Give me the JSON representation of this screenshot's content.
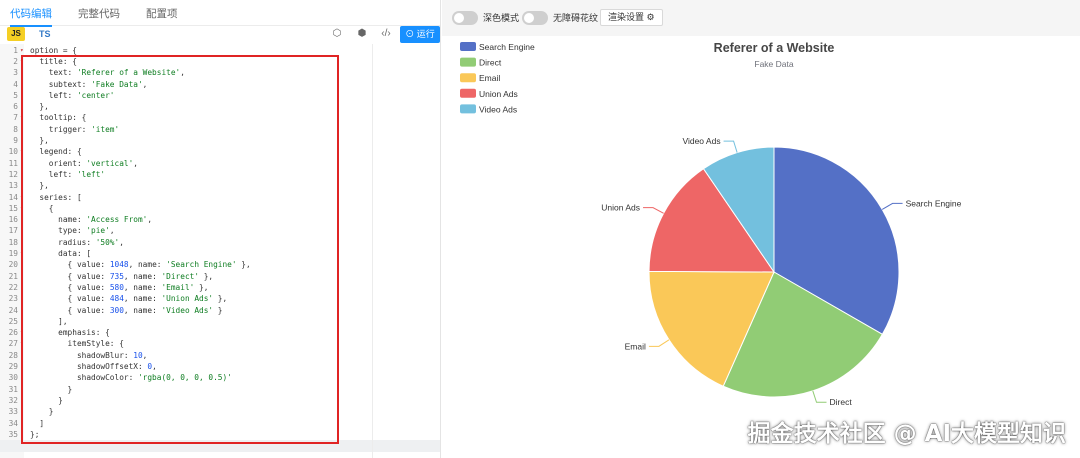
{
  "tabs": [
    {
      "label": "代码编辑",
      "active": true
    },
    {
      "label": "完整代码",
      "active": false
    },
    {
      "label": "配置项",
      "active": false
    }
  ],
  "lang": {
    "js": "JS",
    "ts": "TS"
  },
  "toolbar": {
    "run_label": "⊙ 运行",
    "icons": [
      "cube-outline-icon",
      "cube-solid-icon",
      "code-icon"
    ]
  },
  "editor": {
    "lines": [
      [
        [
          "",
          "option = {"
        ]
      ],
      [
        [
          "",
          "  title: {"
        ]
      ],
      [
        [
          "",
          "    text: "
        ],
        [
          "s",
          "'Referer of a Website'"
        ],
        [
          "",
          ","
        ]
      ],
      [
        [
          "",
          "    subtext: "
        ],
        [
          "s",
          "'Fake Data'"
        ],
        [
          "",
          ","
        ]
      ],
      [
        [
          "",
          "    left: "
        ],
        [
          "s",
          "'center'"
        ]
      ],
      [
        [
          "",
          "  },"
        ]
      ],
      [
        [
          "",
          "  tooltip: {"
        ]
      ],
      [
        [
          "",
          "    trigger: "
        ],
        [
          "s",
          "'item'"
        ]
      ],
      [
        [
          "",
          "  },"
        ]
      ],
      [
        [
          "",
          "  legend: {"
        ]
      ],
      [
        [
          "",
          "    orient: "
        ],
        [
          "s",
          "'vertical'"
        ],
        [
          "",
          ","
        ]
      ],
      [
        [
          "",
          "    left: "
        ],
        [
          "s",
          "'left'"
        ]
      ],
      [
        [
          "",
          "  },"
        ]
      ],
      [
        [
          "",
          "  series: ["
        ]
      ],
      [
        [
          "",
          "    {"
        ]
      ],
      [
        [
          "",
          "      name: "
        ],
        [
          "s",
          "'Access From'"
        ],
        [
          "",
          ","
        ]
      ],
      [
        [
          "",
          "      type: "
        ],
        [
          "s",
          "'pie'"
        ],
        [
          "",
          ","
        ]
      ],
      [
        [
          "",
          "      radius: "
        ],
        [
          "s",
          "'50%'"
        ],
        [
          "",
          ","
        ]
      ],
      [
        [
          "",
          "      data: ["
        ]
      ],
      [
        [
          "",
          "        { value: "
        ],
        [
          "n",
          "1048"
        ],
        [
          "",
          ", name: "
        ],
        [
          "s",
          "'Search Engine'"
        ],
        [
          "",
          " },"
        ]
      ],
      [
        [
          "",
          "        { value: "
        ],
        [
          "n",
          "735"
        ],
        [
          "",
          ", name: "
        ],
        [
          "s",
          "'Direct'"
        ],
        [
          "",
          " },"
        ]
      ],
      [
        [
          "",
          "        { value: "
        ],
        [
          "n",
          "580"
        ],
        [
          "",
          ", name: "
        ],
        [
          "s",
          "'Email'"
        ],
        [
          "",
          " },"
        ]
      ],
      [
        [
          "",
          "        { value: "
        ],
        [
          "n",
          "484"
        ],
        [
          "",
          ", name: "
        ],
        [
          "s",
          "'Union Ads'"
        ],
        [
          "",
          " },"
        ]
      ],
      [
        [
          "",
          "        { value: "
        ],
        [
          "n",
          "300"
        ],
        [
          "",
          ", name: "
        ],
        [
          "s",
          "'Video Ads'"
        ],
        [
          "",
          " }"
        ]
      ],
      [
        [
          "",
          "      ],"
        ]
      ],
      [
        [
          "",
          "      emphasis: {"
        ]
      ],
      [
        [
          "",
          "        itemStyle: {"
        ]
      ],
      [
        [
          "",
          "          shadowBlur: "
        ],
        [
          "n",
          "10"
        ],
        [
          "",
          ","
        ]
      ],
      [
        [
          "",
          "          shadowOffsetX: "
        ],
        [
          "n",
          "0"
        ],
        [
          "",
          ","
        ]
      ],
      [
        [
          "",
          "          shadowColor: "
        ],
        [
          "s",
          "'rgba(0, 0, 0, 0.5)'"
        ]
      ],
      [
        [
          "",
          "        }"
        ]
      ],
      [
        [
          "",
          "      }"
        ]
      ],
      [
        [
          "",
          "    }"
        ]
      ],
      [
        [
          "",
          "  ]"
        ]
      ],
      [
        [
          "",
          "};"
        ]
      ]
    ],
    "fold_lines": [
      1,
      2,
      7,
      10,
      14,
      15,
      19,
      26,
      27
    ]
  },
  "render_bar": {
    "dark_mode_label": "深色模式",
    "a11y_label": "无障碍花纹",
    "render_settings_label": "渲染设置 ⚙"
  },
  "chart_data": {
    "type": "pie",
    "title": "Referer of a Website",
    "subtitle": "Fake Data",
    "legend_position": "top-left",
    "series_name": "Access From",
    "slices": [
      {
        "name": "Search Engine",
        "value": 1048,
        "color": "#5470c6"
      },
      {
        "name": "Direct",
        "value": 735,
        "color": "#91cc75"
      },
      {
        "name": "Email",
        "value": 580,
        "color": "#fac858"
      },
      {
        "name": "Union Ads",
        "value": 484,
        "color": "#ee6666"
      },
      {
        "name": "Video Ads",
        "value": 300,
        "color": "#73c0de"
      }
    ]
  },
  "watermark": "掘金技术社区 @ AI大模型知识"
}
